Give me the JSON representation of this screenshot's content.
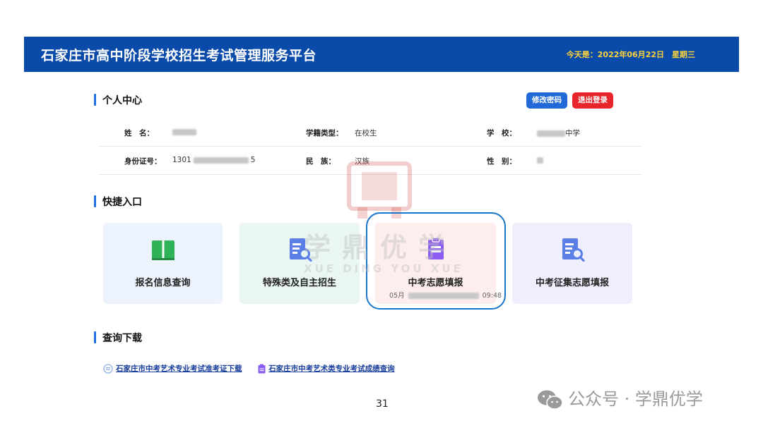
{
  "header": {
    "title": "石家庄市高中阶段学校招生考试管理服务平台",
    "date_text": "今天是：2022年06月22日　星期三"
  },
  "personal": {
    "section_title": "个人中心",
    "change_password": "修改密码",
    "logout": "退出登录",
    "fields": {
      "name_label": "姓　名：",
      "status_label": "学籍类型：",
      "status_value": "在校生",
      "school_label": "学　校：",
      "school_suffix": "中学",
      "id_label": "身份证号：",
      "id_prefix": "1301",
      "id_suffix": "5",
      "ethnicity_label": "民　族：",
      "ethnicity_value": "汉族",
      "gender_label": "性　别："
    }
  },
  "shortcuts": {
    "section_title": "快捷入口",
    "cards": [
      {
        "label": "报名信息查询",
        "icon": "book-icon"
      },
      {
        "label": "特殊类及自主招生",
        "icon": "document-search-icon"
      },
      {
        "label": "中考志愿填报",
        "icon": "clipboard-icon",
        "sub_left": "05月",
        "sub_right": "09:48"
      },
      {
        "label": "中考征集志愿填报",
        "icon": "document-search-icon"
      }
    ]
  },
  "downloads": {
    "section_title": "查询下载",
    "links": [
      "石家庄市中考艺术专业考试准考证下载",
      "石家庄市中考艺术类专业考试成绩查询"
    ]
  },
  "watermark": {
    "text": "学鼎优学",
    "sub": "XUE DING YOU XUE"
  },
  "footer": {
    "page_number": "31",
    "account": "公众号 · 学鼎优学"
  },
  "colors": {
    "header_bg": "#0a4aa8",
    "date_text": "#ffd43a",
    "accent_blue": "#2169d6",
    "logout_red": "#e8252b",
    "highlight": "#1976c8"
  }
}
